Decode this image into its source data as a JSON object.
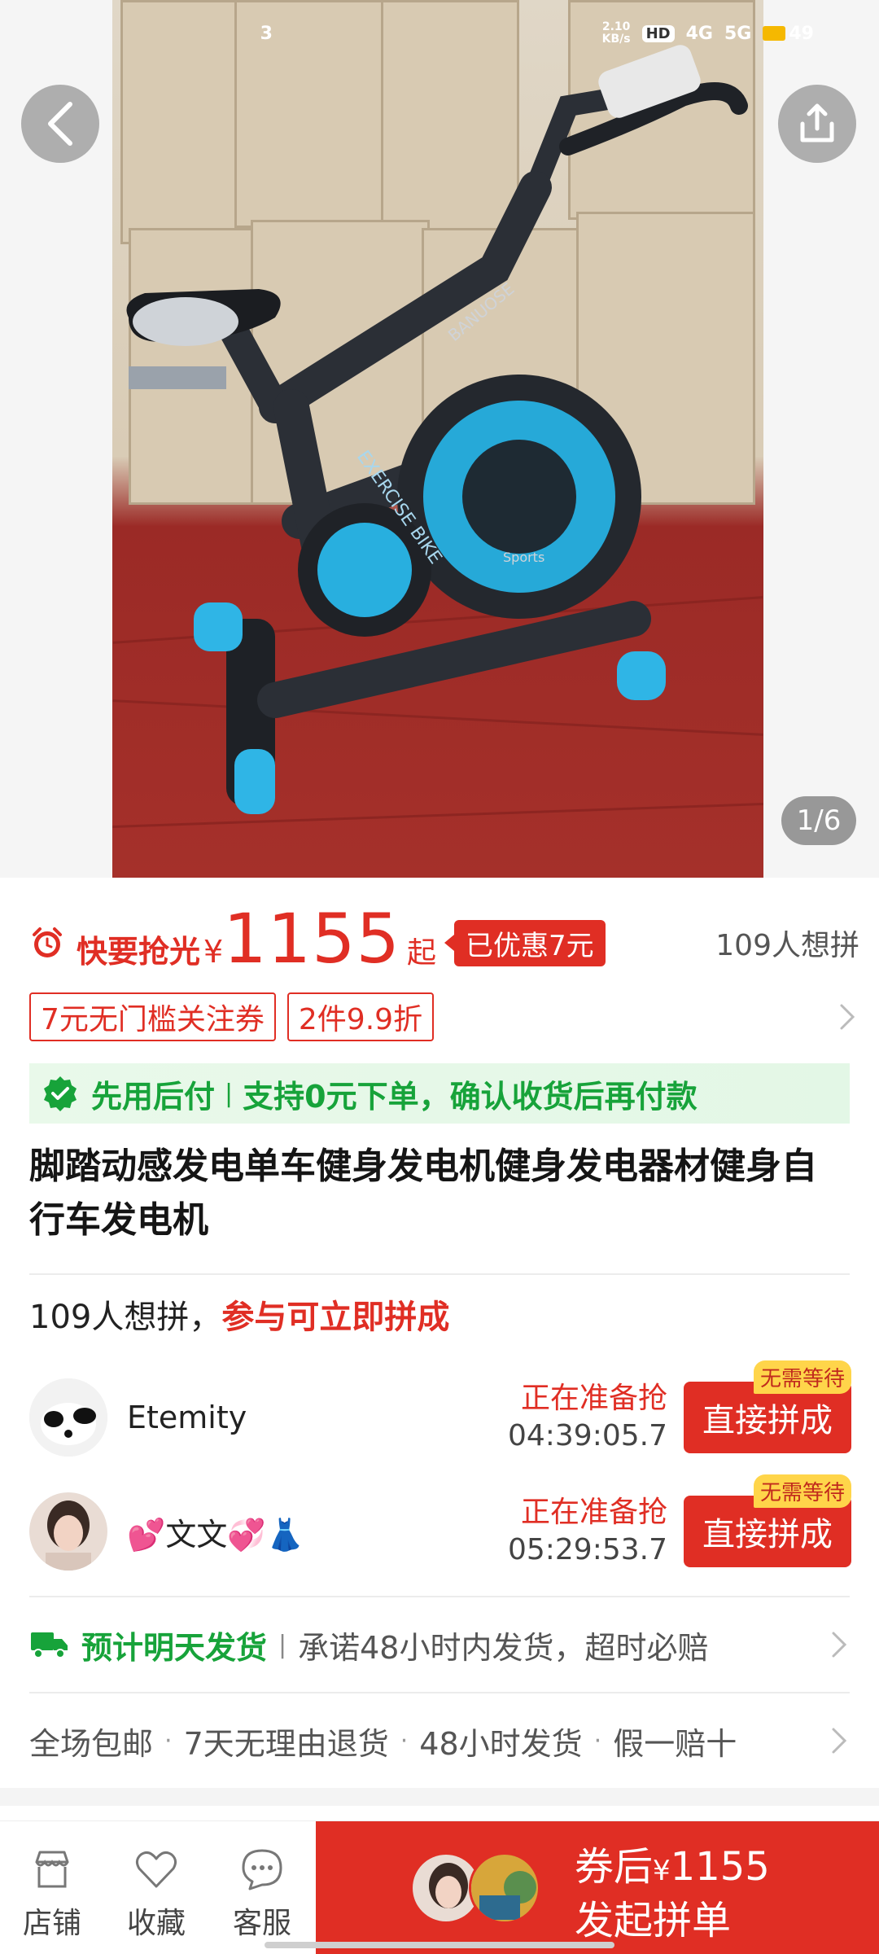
{
  "status_bar": {
    "time": "3",
    "net_speed": "2.10\nKB/s",
    "hd": "HD",
    "signal_1": "4G",
    "signal_2": "5G",
    "battery": "49"
  },
  "gallery": {
    "pager": "1/6",
    "photo_text": [
      "EXERCISE BIKE",
      "BANUOSE",
      "Sports"
    ]
  },
  "price": {
    "rush_label": "快要抢光",
    "yen": "¥",
    "amount": "1155",
    "suffix": "起",
    "discount_tag": "已优惠7元",
    "want_count": "109人想拼"
  },
  "coupons": [
    "7元无门槛关注券",
    "2件9.9折"
  ],
  "pay_later": {
    "title": "先用后付",
    "desc": "支持0元下单，确认收货后再付款"
  },
  "product": {
    "title": "脚踏动感发电单车健身发电机健身发电器材健身自行车发电机"
  },
  "group": {
    "head_prefix": "109人想拼，",
    "head_highlight": "参与可立即拼成",
    "rows": [
      {
        "name": "Etemity",
        "status": "正在准备抢",
        "countdown": "04:39:05.7",
        "button": "直接拼成",
        "badge": "无需等待"
      },
      {
        "name": "💕文文💞👗",
        "status": "正在准备抢",
        "countdown": "05:29:53.7",
        "button": "直接拼成",
        "badge": "无需等待"
      }
    ]
  },
  "shipping": {
    "highlight": "预计明天发货",
    "promise": "承诺48小时内发货，超时必赔"
  },
  "services": [
    "全场包邮",
    "7天无理由退货",
    "48小时发货",
    "假一赔十"
  ],
  "bottom_bar": {
    "store": "店铺",
    "favorite": "收藏",
    "service": "客服",
    "buy_line1_prefix": "券后",
    "buy_yen": "¥",
    "buy_price": "1155",
    "buy_line2": "发起拼单"
  },
  "colors": {
    "brand_red": "#e02e24",
    "green": "#17a33a",
    "badge_yellow": "#ffd54a"
  }
}
